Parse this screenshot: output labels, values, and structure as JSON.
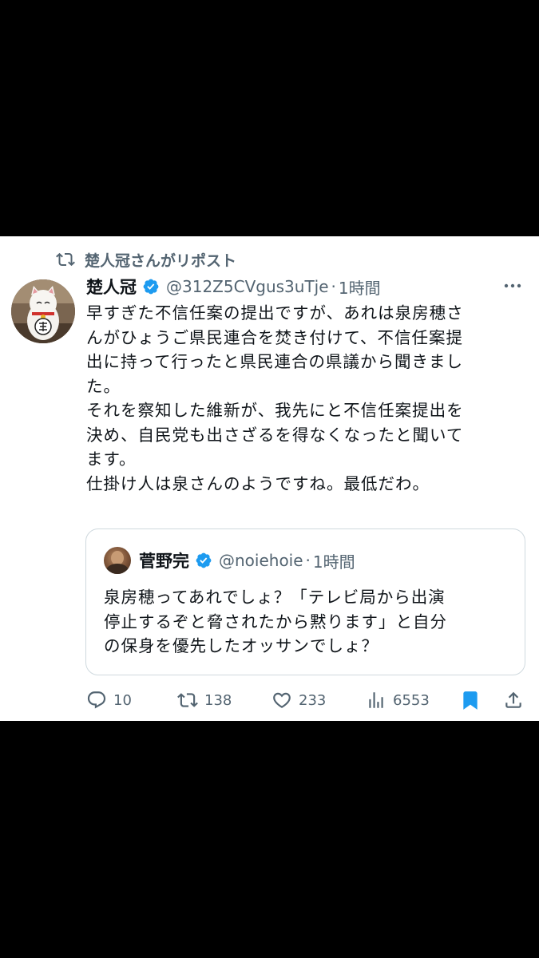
{
  "repost": {
    "label": "楚人冠さんがリポスト"
  },
  "tweet": {
    "author_name": "楚人冠",
    "handle": "@312Z5CVgus3uTje",
    "separator": "·",
    "time": "1時間",
    "text": "早すぎた不信任案の提出ですが、あれは泉房穂さ\nんがひょうご県民連合を焚き付けて、不信任案提\n出に持って行ったと県民連合の県議から聞きまし\nた。\nそれを察知した維新が、我先にと不信任案提出を\n決め、自民党も出さざるを得なくなったと聞いて\nます。\n仕掛け人は泉さんのようですね。最低だわ。"
  },
  "quote": {
    "author_name": "菅野完",
    "handle": "@noiehoie",
    "separator": "·",
    "time": "1時間",
    "text": "泉房穂ってあれでしょ？「テレビ局から出演\n停止するぞと脅されたから黙ります」と自分\nの保身を優先したオッサンでしょ？"
  },
  "actions": {
    "replies": "10",
    "reposts": "138",
    "likes": "233",
    "views": "6553"
  },
  "colors": {
    "verified": "#1d9bf0",
    "bookmark": "#1d9bf0",
    "muted": "#536471"
  }
}
